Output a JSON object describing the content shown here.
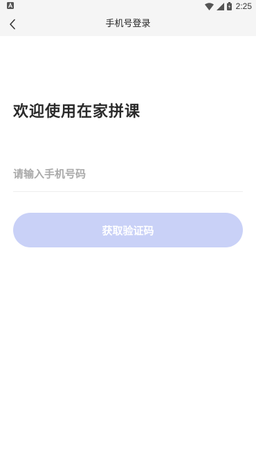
{
  "status_bar": {
    "time": "2:25",
    "left_icon": "a-notification-icon",
    "icons": [
      "wifi-icon",
      "signal-icon",
      "battery-icon"
    ]
  },
  "nav": {
    "back_icon": "chevron-left-icon",
    "title": "手机号登录"
  },
  "welcome": {
    "title": "欢迎使用在家拼课"
  },
  "phone": {
    "placeholder": "请输入手机号码",
    "value": ""
  },
  "actions": {
    "get_code_label": "获取验证码"
  },
  "colors": {
    "button_disabled": "#c9d1f7",
    "bar_background": "#f5f5f5",
    "placeholder": "#a9a9a9"
  }
}
